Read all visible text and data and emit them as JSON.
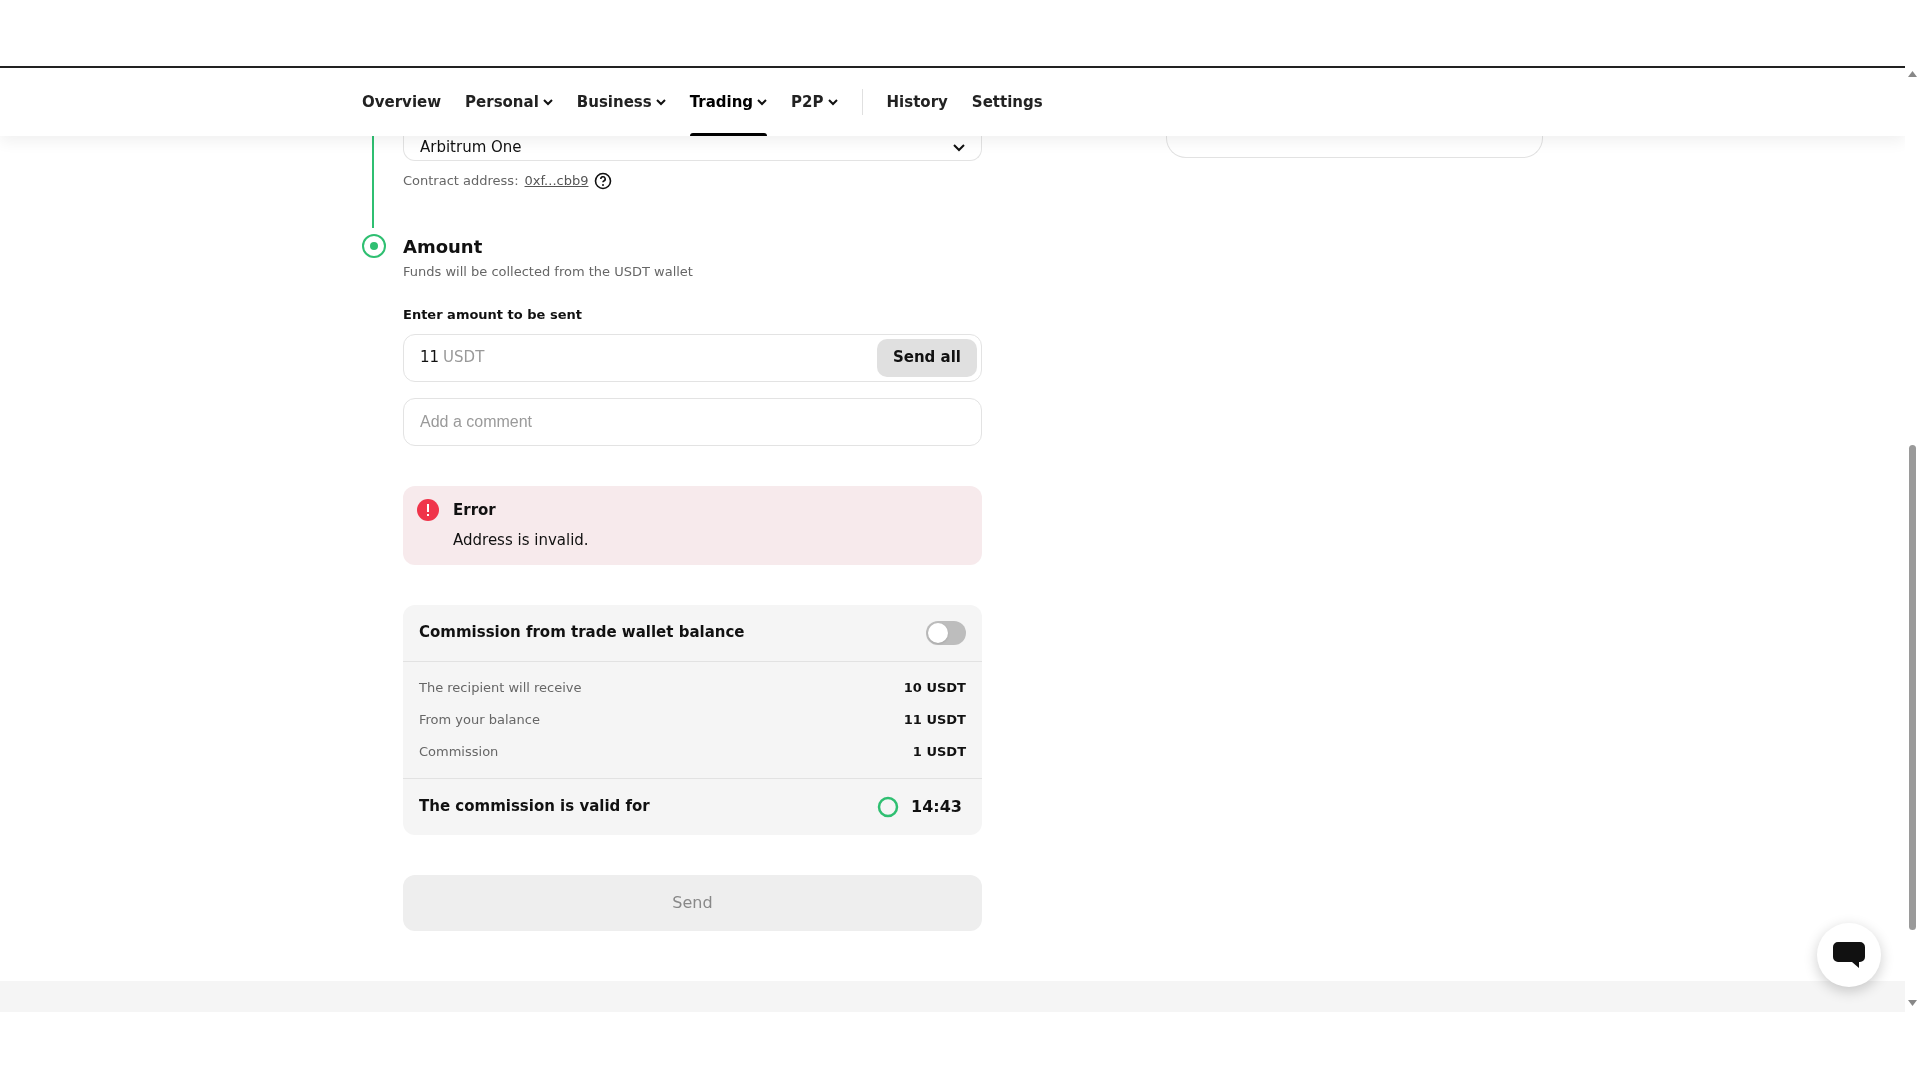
{
  "nav": {
    "main_items": [
      {
        "label": "Overview",
        "dropdown": false,
        "selected": false
      },
      {
        "label": "Personal",
        "dropdown": true,
        "selected": false
      },
      {
        "label": "Business",
        "dropdown": true,
        "selected": false
      },
      {
        "label": "Trading",
        "dropdown": true,
        "selected": true
      },
      {
        "label": "P2P",
        "dropdown": true,
        "selected": false
      }
    ],
    "secondary_items": [
      {
        "label": "History",
        "dropdown": false,
        "selected": false
      },
      {
        "label": "Settings",
        "dropdown": false,
        "selected": false
      }
    ]
  },
  "network_select": {
    "value": "Arbitrum One"
  },
  "contract": {
    "label": "Contract address:",
    "link": "0xf...cbb9"
  },
  "step": {
    "title": "Amount",
    "subtitle": "Funds will be collected from the USDT wallet",
    "active": true
  },
  "amount": {
    "label": "Enter amount to be sent",
    "value": "11",
    "unit": "USDT",
    "button": "Send all"
  },
  "comment": {
    "placeholder": "Add a comment"
  },
  "error": {
    "title": "Error",
    "message": "Address is invalid."
  },
  "commission": {
    "title": "Commission from trade wallet balance",
    "on": false,
    "rows": [
      {
        "label": "The recipient will receive",
        "value": "10 USDT"
      },
      {
        "label": "From your balance",
        "value": "11 USDT"
      },
      {
        "label": "Commission",
        "value": "1 USDT"
      }
    ],
    "validity": {
      "label": "The commission is valid for",
      "time": "14:43"
    }
  },
  "send_button": {
    "label": "Send",
    "disabled": true
  }
}
